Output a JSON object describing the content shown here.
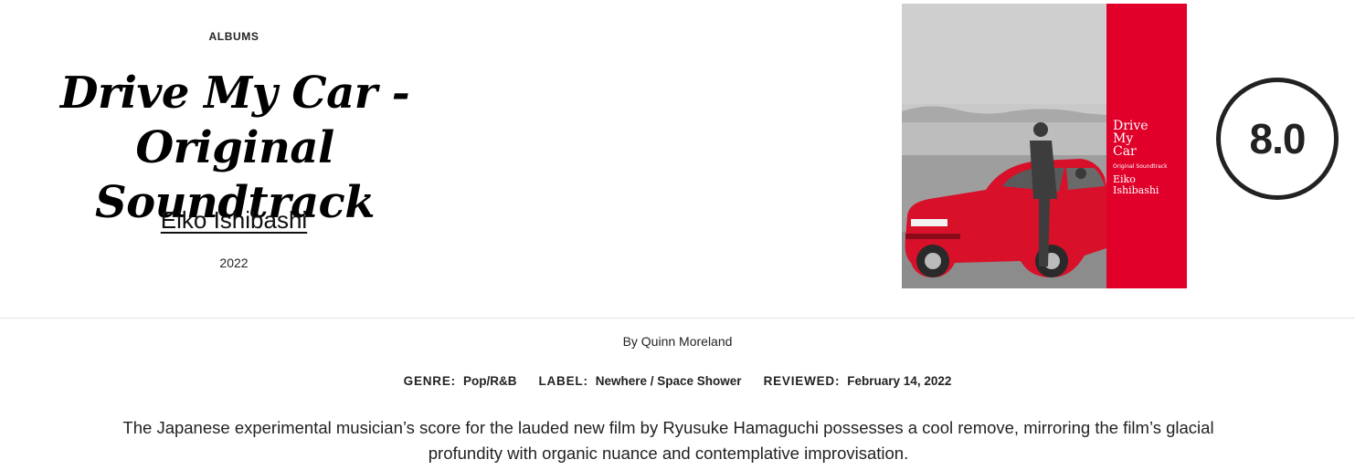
{
  "header": {
    "category": "ALBUMS",
    "title": "Drive My Car - Original Soundtrack",
    "artist": "Eiko Ishibashi",
    "year": "2022"
  },
  "cover": {
    "text_lines": [
      "Drive",
      "My",
      "Car",
      "Original Soundtrack",
      "Eiko",
      "Ishibashi"
    ],
    "band_color": "#e0002a",
    "car_color": "#d8102a"
  },
  "score": {
    "value": "8.0"
  },
  "byline": {
    "prefix": "By",
    "author": "Quinn Moreland"
  },
  "meta": {
    "genre_label": "GENRE:",
    "genre_value": "Pop/R&B",
    "label_label": "LABEL:",
    "label_value": "Newhere / Space Shower",
    "reviewed_label": "REVIEWED:",
    "reviewed_value": "February 14, 2022"
  },
  "dek": "The Japanese experimental musician’s score for the lauded new film by Ryusuke Hamaguchi possesses a cool remove, mirroring the film’s glacial profundity with organic nuance and contemplative improvisation."
}
